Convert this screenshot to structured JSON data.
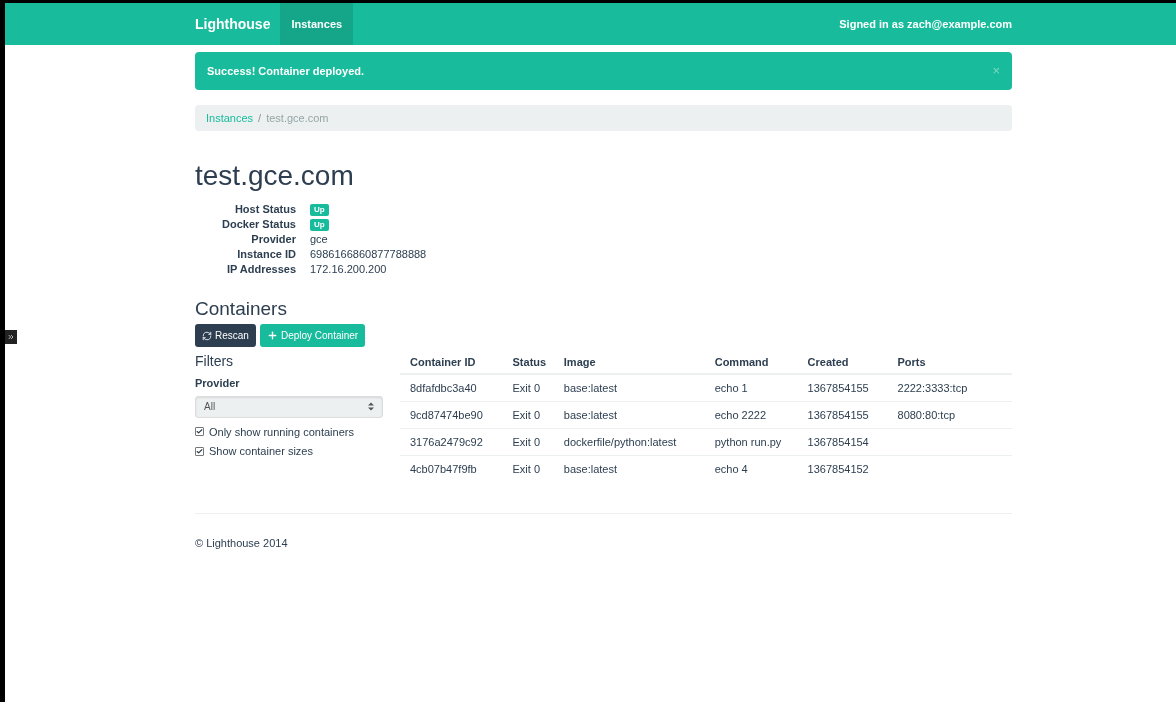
{
  "navbar": {
    "brand": "Lighthouse",
    "items": [
      {
        "label": "Instances",
        "selected": true
      }
    ],
    "signed_in": "Signed in as zach@example.com"
  },
  "alert": {
    "text": "Success! Container deployed.",
    "close": "×"
  },
  "breadcrumb": [
    {
      "label": "Instances",
      "kind": "link"
    },
    {
      "label": "test.gce.com",
      "kind": "current"
    }
  ],
  "breadcrumb_separator": "/",
  "title": "test.gce.com",
  "details": [
    {
      "label": "Host Status",
      "value": "Up",
      "kind": "badge"
    },
    {
      "label": "Docker Status",
      "value": "Up",
      "kind": "badge"
    },
    {
      "label": "Provider",
      "value": "gce",
      "kind": "text"
    },
    {
      "label": "Instance ID",
      "value": "6986166860877788888",
      "kind": "text"
    },
    {
      "label": "IP Addresses",
      "value": "172.16.200.200",
      "kind": "text"
    }
  ],
  "containers_heading": "Containers",
  "buttons": [
    {
      "label": "Rescan",
      "kind": "dark"
    },
    {
      "label": "Deploy Container",
      "kind": "primary"
    }
  ],
  "filters": {
    "heading": "Filters",
    "provider_label": "Provider",
    "provider_value": "All",
    "checkboxes": [
      {
        "label": "Only show running containers",
        "checked": true
      },
      {
        "label": "Show container sizes",
        "checked": true
      }
    ]
  },
  "table": {
    "columns": [
      "Container ID",
      "Status",
      "Image",
      "Command",
      "Created",
      "Ports"
    ],
    "rows": [
      [
        "8dfafdbc3a40",
        "Exit 0",
        "base:latest",
        "echo 1",
        "1367854155",
        "2222:3333:tcp"
      ],
      [
        "9cd87474be90",
        "Exit 0",
        "base:latest",
        "echo 2222",
        "1367854155",
        "8080:80:tcp"
      ],
      [
        "3176a2479c92",
        "Exit 0",
        "dockerfile/python:latest",
        "python run.py",
        "1367854154",
        ""
      ],
      [
        "4cb07b47f9fb",
        "Exit 0",
        "base:latest",
        "echo 4",
        "1367854152",
        ""
      ]
    ]
  },
  "footer": "© Lighthouse 2014"
}
